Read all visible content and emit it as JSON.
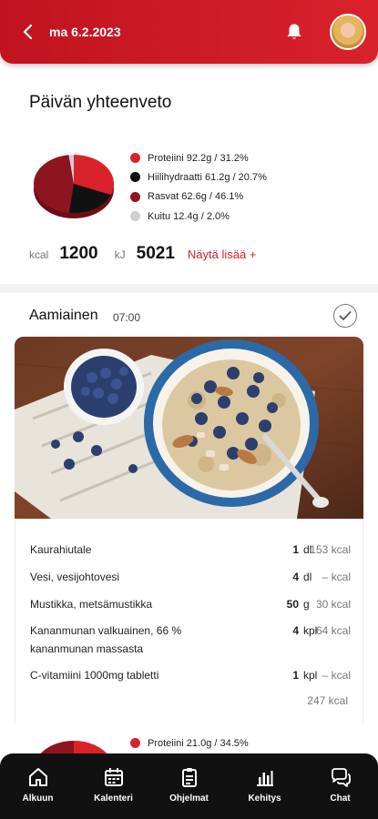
{
  "header": {
    "date": "ma 6.2.2023"
  },
  "summary": {
    "title": "Päivän yhteenveto",
    "macros": [
      {
        "label": "Proteiini 92.2g / 31.2%",
        "color": "#d9222c",
        "percent": 31.2
      },
      {
        "label": "Hiilihydraatti 61.2g / 20.7%",
        "color": "#111111",
        "percent": 20.7
      },
      {
        "label": "Rasvat 62.6g / 46.1%",
        "color": "#8e1520",
        "percent": 46.1
      },
      {
        "label": "Kuitu 12.4g / 2.0%",
        "color": "#cfcfcf",
        "percent": 2.0
      }
    ],
    "kcal_label": "kcal",
    "kcal_value": "1200",
    "kj_label": "kJ",
    "kj_value": "5021",
    "more_link": "Näytä lisää +"
  },
  "meal": {
    "title": "Aamiainen",
    "time": "07:00",
    "items": [
      {
        "name": "Kaurahiutale",
        "qty": "1",
        "unit": "dl",
        "kcal": "153 kcal"
      },
      {
        "name": "Vesi, vesijohtovesi",
        "qty": "4",
        "unit": "dl",
        "kcal": "– kcal"
      },
      {
        "name": "Mustikka, metsämustikka",
        "qty": "50",
        "unit": "g",
        "kcal": "30 kcal"
      },
      {
        "name": "Kananmunan valkuainen, 66 % kananmunan massasta",
        "qty": "4",
        "unit": "kpl",
        "kcal": "64 kcal"
      },
      {
        "name": "C-vitamiini 1000mg tabletti",
        "qty": "1",
        "unit": "kpl",
        "kcal": "– kcal"
      }
    ],
    "total": "247 kcal"
  },
  "next_meal": {
    "macros": [
      {
        "label": "Proteiini 21.0g / 34.5%",
        "color": "#d9222c",
        "percent": 34.5
      }
    ]
  },
  "nav": {
    "items": [
      {
        "label": "Alkuun",
        "icon": "home-icon"
      },
      {
        "label": "Kalenteri",
        "icon": "calendar-icon"
      },
      {
        "label": "Ohjelmat",
        "icon": "clipboard-icon"
      },
      {
        "label": "Kehitys",
        "icon": "bar-chart-icon"
      },
      {
        "label": "Chat",
        "icon": "chat-icon"
      }
    ]
  }
}
